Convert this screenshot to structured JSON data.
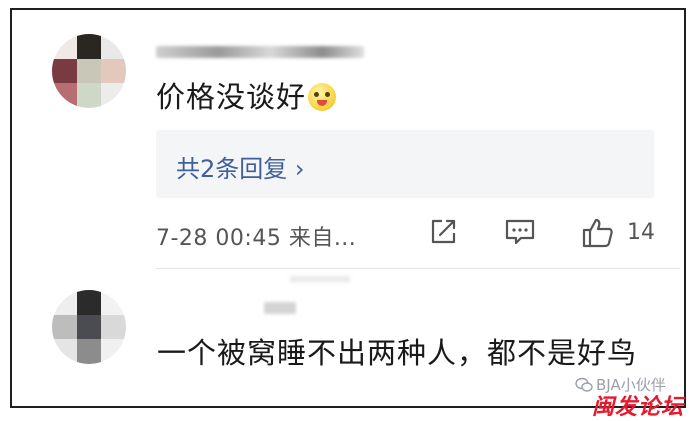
{
  "comments": [
    {
      "text": "价格没谈好",
      "reply_count_label": "共2条回复 ›",
      "meta": "7-28 00:45 来自...",
      "like_count": "14"
    },
    {
      "text": "一个被窝睡不出两种人，都不是好鸟"
    }
  ],
  "icons": {
    "emoji": "grinning-face-icon",
    "share": "share-icon",
    "comment": "comment-icon",
    "like": "thumbs-up-icon"
  },
  "watermarks": {
    "account": "BJA小伙伴",
    "site": "闽发论坛"
  },
  "colors": {
    "text": "#1a1a1a",
    "meta": "#555555",
    "reply_link": "#3e5f9b",
    "reply_bg": "#f4f5f7",
    "watermark_red": "#e8192c"
  }
}
